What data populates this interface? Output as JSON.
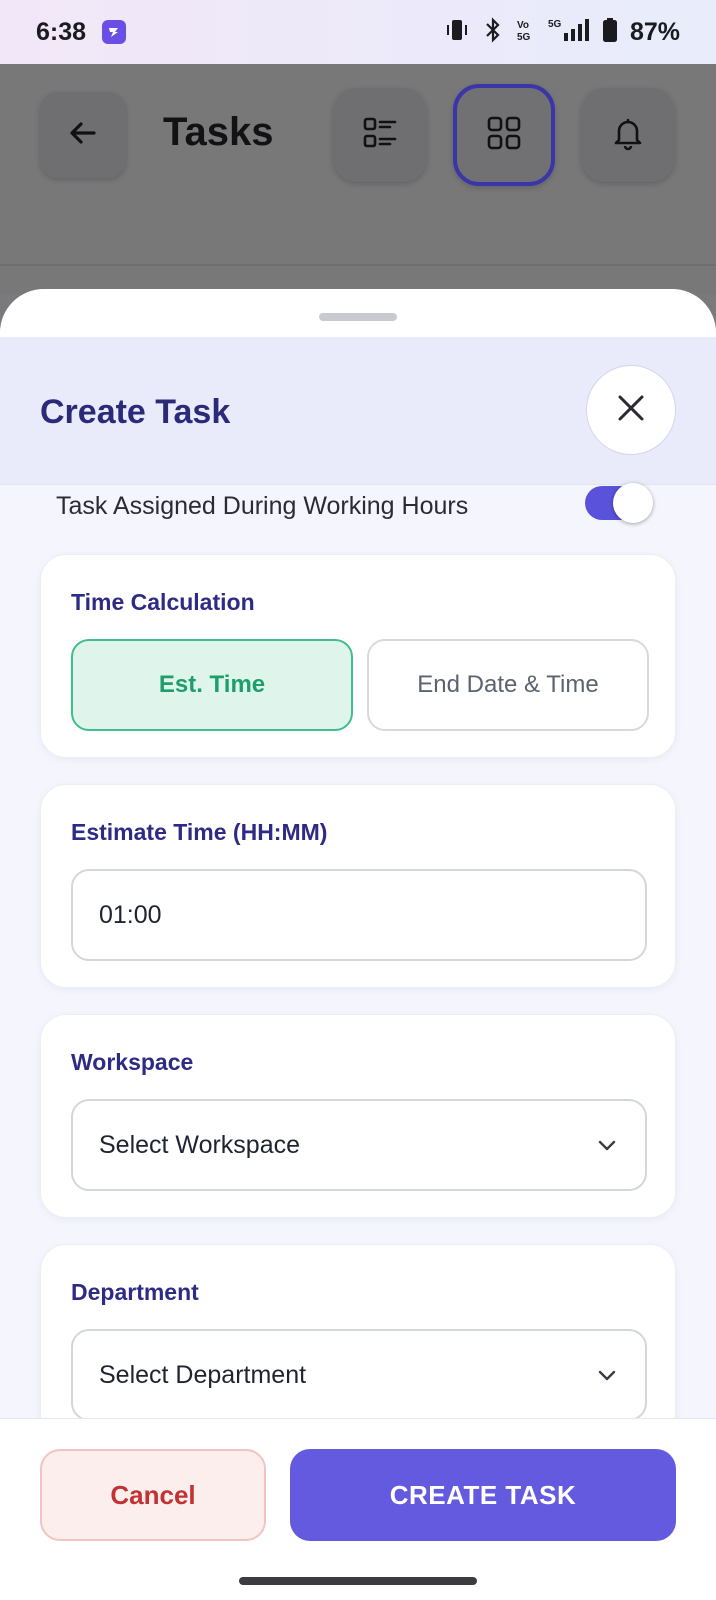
{
  "status_bar": {
    "time": "6:38",
    "battery": "87%",
    "app_icon": "app-shortcut-icon",
    "icons": [
      "vibrate-icon",
      "bluetooth-icon",
      "volte-icon",
      "signal-5g-icon",
      "battery-icon"
    ]
  },
  "app_header": {
    "title": "Tasks",
    "icons": [
      "back-arrow-icon",
      "list-view-icon",
      "grid-view-icon",
      "bell-icon"
    ],
    "active_view": "grid"
  },
  "sheet": {
    "title": "Create Task",
    "close_icon": "close-icon",
    "working_hours_toggle": {
      "label": "Task Assigned During Working Hours",
      "enabled": true
    },
    "time_calculation": {
      "title": "Time Calculation",
      "options": [
        "Est. Time",
        "End Date & Time"
      ],
      "selected": "Est. Time"
    },
    "estimate_time": {
      "title": "Estimate Time (HH:MM)",
      "value": "01:00"
    },
    "workspace": {
      "title": "Workspace",
      "placeholder": "Select Workspace"
    },
    "department": {
      "title": "Department",
      "placeholder": "Select Department"
    }
  },
  "footer": {
    "cancel_label": "Cancel",
    "create_label": "CREATE TASK"
  },
  "colors": {
    "primary": "#635ae0",
    "accent_green": "#3fbf8e",
    "title_indigo": "#2e2b86",
    "cancel_red": "#c23232"
  }
}
